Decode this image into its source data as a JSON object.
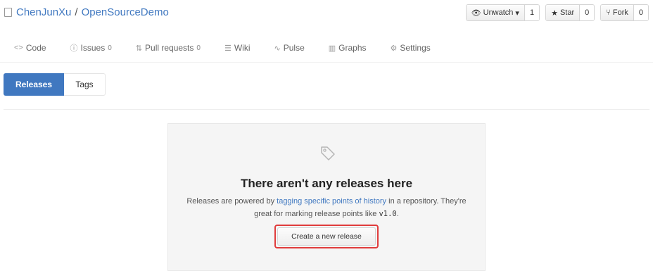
{
  "header": {
    "owner": "ChenJunXu",
    "separator": "/",
    "repo": "OpenSourceDemo",
    "watch": {
      "label": "Unwatch",
      "caret": "▾",
      "count": "1"
    },
    "star": {
      "label": "Star",
      "count": "0"
    },
    "fork": {
      "label": "Fork",
      "count": "0"
    }
  },
  "nav": {
    "code": "Code",
    "issues": {
      "label": "Issues",
      "count": "0"
    },
    "pulls": {
      "label": "Pull requests",
      "count": "0"
    },
    "wiki": "Wiki",
    "pulse": "Pulse",
    "graphs": "Graphs",
    "settings": "Settings"
  },
  "tabs": {
    "releases": "Releases",
    "tags": "Tags"
  },
  "blank": {
    "title": "There aren't any releases here",
    "desc_pre": "Releases are powered by ",
    "desc_link": "tagging specific points of history",
    "desc_mid": " in a repository. They're great for marking release points like ",
    "desc_code": "v1.0",
    "desc_end": ".",
    "create_button": "Create a new release"
  }
}
